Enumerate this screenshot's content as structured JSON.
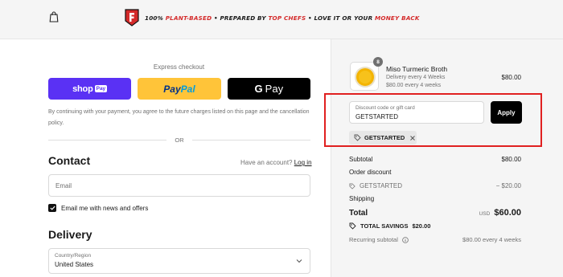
{
  "header": {
    "tagline_part1": "100% ",
    "tagline_part2": "Plant-based",
    "tagline_part3": " • Prepared by ",
    "tagline_part4": "Top Chefs",
    "tagline_part5": " • Love it or your ",
    "tagline_part6": "money back",
    "icons": {
      "bag": "shopping-bag-icon",
      "logo": "brand-logo"
    },
    "accent_color": "#d42a2a"
  },
  "express": {
    "title": "Express checkout",
    "shop_pay": {
      "text": "shop",
      "badge": "Pay",
      "color": "#5a31f4"
    },
    "paypal": {
      "text1": "Pay",
      "text2": "Pal",
      "color": "#ffc439"
    },
    "gpay": {
      "g": "G",
      "text": "Pay",
      "color": "#000000"
    },
    "consent": "By continuing with your payment, you agree to the future charges listed on this page and the cancellation policy.",
    "or_label": "OR"
  },
  "contact": {
    "heading": "Contact",
    "have_account": "Have an account?",
    "login_label": "Log in",
    "email_placeholder": "Email",
    "news_label": "Email me with news and offers",
    "news_checked": true
  },
  "delivery": {
    "heading": "Delivery",
    "country_label": "Country/Region",
    "country_value": "United States"
  },
  "summary": {
    "product": {
      "qty": "8",
      "name": "Miso Turmeric Broth",
      "sub1": "Delivery every 4 Weeks",
      "sub2": "$80.00 every 4 weeks",
      "price": "$80.00"
    },
    "discount": {
      "placeholder": "Discount code or gift card",
      "value": "GETSTARTED",
      "apply_label": "Apply",
      "chip_label": "GETSTARTED"
    },
    "subtotal_label": "Subtotal",
    "subtotal_value": "$80.00",
    "order_discount_label": "Order discount",
    "discount_code": "GETSTARTED",
    "discount_value": "− $20.00",
    "shipping_label": "Shipping",
    "total_label": "Total",
    "total_currency": "USD",
    "total_value": "$60.00",
    "savings_label": "TOTAL SAVINGS",
    "savings_value": "$20.00",
    "recurring_label": "Recurring subtotal",
    "recurring_value": "$80.00 every 4 weeks",
    "highlight_color": "#e02020"
  }
}
